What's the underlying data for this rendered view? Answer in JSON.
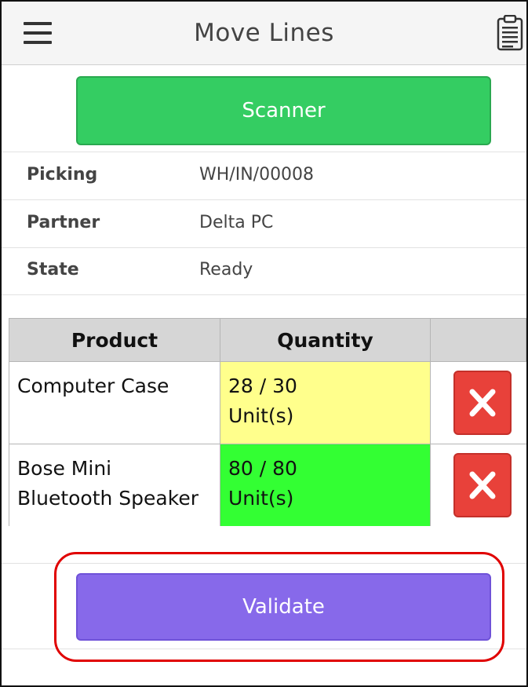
{
  "header": {
    "title": "Move Lines",
    "menu_icon": "hamburger-menu-icon",
    "clipboard_icon": "clipboard-icon"
  },
  "scanner_label": "Scanner",
  "info": {
    "picking_label": "Picking",
    "picking_value": "WH/IN/00008",
    "partner_label": "Partner",
    "partner_value": "Delta PC",
    "state_label": "State",
    "state_value": "Ready"
  },
  "table": {
    "headers": [
      "Product",
      "Quantity",
      ""
    ],
    "rows": [
      {
        "product": "Computer Case",
        "quantity": "28 / 30",
        "unit": "Unit(s)",
        "status_color": "#ffff8c"
      },
      {
        "product_line1": "Bose Mini",
        "product_line2": "Bluetooth Speaker",
        "quantity": "80 / 80",
        "unit": "Unit(s)",
        "status_color": "#33ff33"
      }
    ]
  },
  "validate_label": "Validate",
  "colors": {
    "scanner": "#34cd62",
    "validate": "#8769ea",
    "delete": "#e8413a",
    "highlight": "#e00000"
  }
}
